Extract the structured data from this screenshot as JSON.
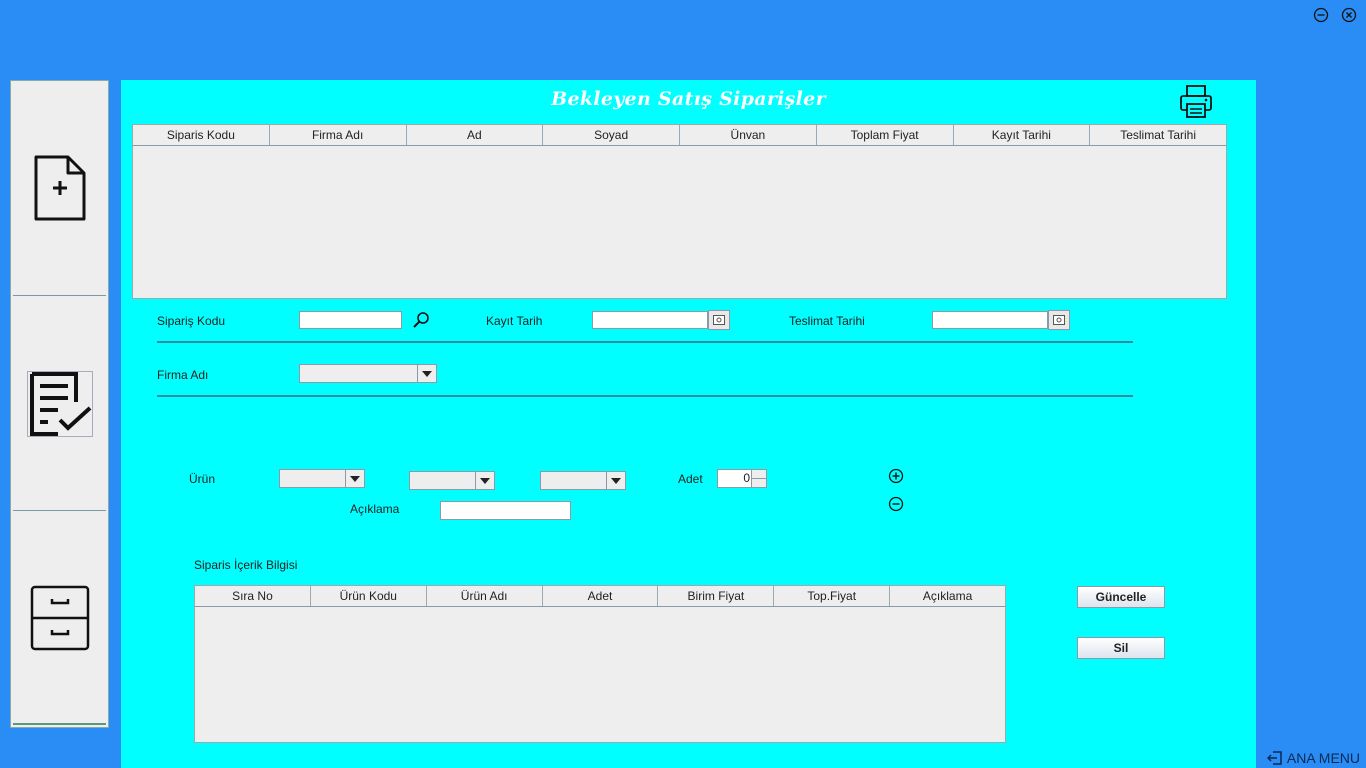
{
  "window": {
    "minimize_icon": "minus-circle-icon",
    "close_icon": "x-circle-icon"
  },
  "sidebar": {
    "items": [
      {
        "icon": "new-document-icon"
      },
      {
        "icon": "checklist-icon"
      },
      {
        "icon": "archive-cabinet-icon"
      }
    ]
  },
  "main": {
    "title": "Bekleyen Satış Siparişler",
    "print_icon": "printer-icon",
    "orders_table": {
      "columns": [
        "Siparis Kodu",
        "Firma Adı",
        "Ad",
        "Soyad",
        "Ünvan",
        "Toplam Fiyat",
        "Kayıt Tarihi",
        "Teslimat Tarihi"
      ],
      "rows": []
    },
    "form": {
      "order_code_label": "Sipariş Kodu",
      "order_code_value": "",
      "register_date_label": "Kayıt Tarih",
      "register_date_value": "",
      "delivery_date_label": "Teslimat Tarihi",
      "delivery_date_value": "",
      "company_label": "Firma Adı",
      "company_value": "",
      "product_label": "Ürün",
      "quantity_label": "Adet",
      "quantity_value": "0",
      "description_label": "Açıklama",
      "description_value": ""
    },
    "content_section_label": "Siparis İçerik Bilgisi",
    "content_table": {
      "columns": [
        "Sıra No",
        "Ürün Kodu",
        "Ürün Adı",
        "Adet",
        "Birim Fiyat",
        "Top.Fiyat",
        "Açıklama"
      ],
      "rows": []
    },
    "buttons": {
      "update": "Güncelle",
      "delete": "Sil"
    }
  },
  "footer": {
    "main_menu": "ANA MENU"
  },
  "colors": {
    "background": "#2a8cf5",
    "panel": "#00ffff",
    "title": "#ffffff",
    "divider": "#2e8ca0"
  }
}
